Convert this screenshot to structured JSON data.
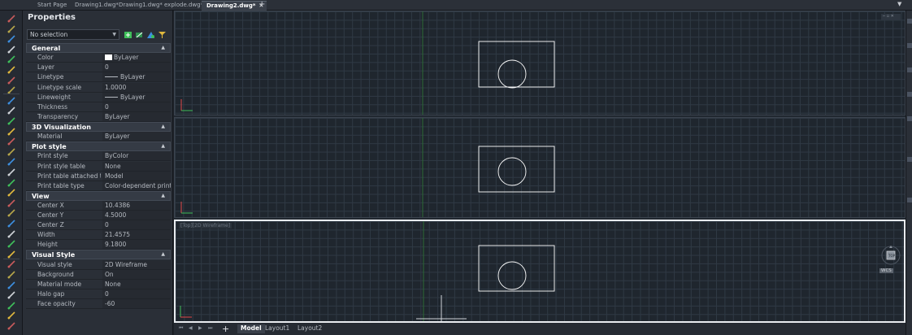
{
  "tabs": [
    {
      "label": "Start Page",
      "active": false
    },
    {
      "label": "Drawing1.dwg*",
      "active": false
    },
    {
      "label": "Drawing1.dwg*",
      "active": false
    },
    {
      "label": "explode.dwg*",
      "active": false
    },
    {
      "label": "Drawing2.dwg*",
      "active": true
    }
  ],
  "tab_close_glyph": "✕",
  "tab_add_glyph": "+",
  "properties": {
    "title": "Properties",
    "selection": "No selection",
    "sections": [
      {
        "title": "General",
        "rows": [
          {
            "label": "Color",
            "value": "ByLayer",
            "decor": "swatch"
          },
          {
            "label": "Layer",
            "value": "0"
          },
          {
            "label": "Linetype",
            "value": "ByLayer",
            "decor": "dash"
          },
          {
            "label": "Linetype scale",
            "value": "1.0000"
          },
          {
            "label": "Lineweight",
            "value": "ByLayer",
            "decor": "dash"
          },
          {
            "label": "Thickness",
            "value": "0"
          },
          {
            "label": "Transparency",
            "value": "ByLayer"
          }
        ]
      },
      {
        "title": "3D Visualization",
        "rows": [
          {
            "label": "Material",
            "value": "ByLayer"
          }
        ]
      },
      {
        "title": "Plot style",
        "rows": [
          {
            "label": "Print style",
            "value": "ByColor"
          },
          {
            "label": "Print style table",
            "value": "None"
          },
          {
            "label": "Print table attached to",
            "value": "Model"
          },
          {
            "label": "Print table type",
            "value": "Color-dependent print..."
          }
        ]
      },
      {
        "title": "View",
        "rows": [
          {
            "label": "Center X",
            "value": "10.4386"
          },
          {
            "label": "Center Y",
            "value": "4.5000"
          },
          {
            "label": "Center Z",
            "value": "0"
          },
          {
            "label": "Width",
            "value": "21.4575"
          },
          {
            "label": "Height",
            "value": "9.1800"
          }
        ]
      },
      {
        "title": "Visual Style",
        "rows": [
          {
            "label": "Visual style",
            "value": "2D Wireframe"
          },
          {
            "label": "Background",
            "value": "On"
          },
          {
            "label": "Material mode",
            "value": "None"
          },
          {
            "label": "Halo gap",
            "value": "0"
          },
          {
            "label": "Face opacity",
            "value": "-60"
          }
        ]
      }
    ]
  },
  "viewport_label": "[Top][2D Wireframe]",
  "wcs_label": "WCS",
  "layout_tabs": [
    {
      "label": "Model",
      "active": true
    },
    {
      "label": "Layout1",
      "active": false
    },
    {
      "label": "Layout2",
      "active": false
    }
  ],
  "colors": {
    "accent_red": "#e04848",
    "accent_green": "#3fbf5a",
    "accent_blue": "#3d8fe0",
    "drawing_bg": "#1f262e",
    "line_white": "#ffffff"
  }
}
